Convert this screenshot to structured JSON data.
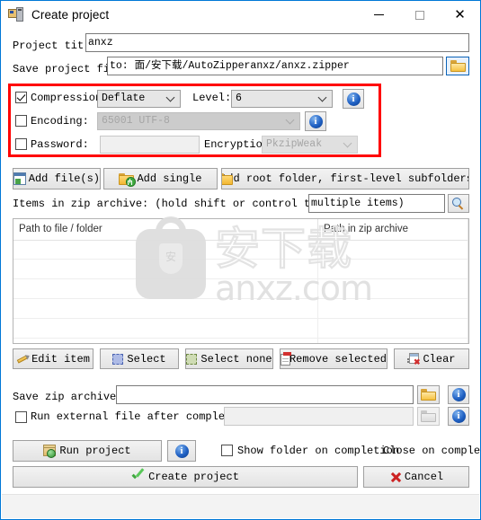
{
  "window": {
    "title": "Create project",
    "icon": "computer-project-icon",
    "minimize": "—",
    "maximize": "□",
    "close": "✕",
    "accent": "#0078d7",
    "highlight_color": "#ff0000"
  },
  "project": {
    "title_label": "Project tit",
    "title_value": "anxz",
    "save_file_label": "Save project file",
    "save_file_value": "to: 面/安下载/AutoZipperanxz/anxz.zipper",
    "browse_icon": "folder-open-icon"
  },
  "options": {
    "compression": {
      "label": "Compression:",
      "checked": true,
      "value": "Deflate"
    },
    "level": {
      "label": "Level:",
      "value": "6"
    },
    "compression_info_icon": "info-icon",
    "encoding": {
      "label": "Encoding:",
      "checked": false,
      "value": "65001 UTF-8",
      "disabled": true
    },
    "encoding_info_icon": "info-icon",
    "password": {
      "label": "Password:",
      "checked": false,
      "value": ""
    },
    "encryption": {
      "label": "Encryption:",
      "value": "PkzipWeak",
      "disabled": true
    }
  },
  "add_buttons": [
    {
      "label": "Add file(s)",
      "icon": "add-file-icon"
    },
    {
      "label": "Add single",
      "icon": "add-folder-icon"
    },
    {
      "label": "Add root folder, first-level subfolders",
      "icon": "add-root-folder-icon"
    }
  ],
  "items_bar": {
    "label": "Items in zip archive: (hold shift or control to select",
    "field_value": "multiple items)",
    "search_icon": "magnifier-icon"
  },
  "list": {
    "columns": [
      "Path to file / folder",
      "Path in zip archive"
    ],
    "rows": [],
    "empty_row_count": 6
  },
  "watermark": {
    "chinese": "安下载",
    "domain": "anxz.com",
    "shield_char": "安"
  },
  "item_buttons": [
    {
      "label": "Edit item",
      "icon": "pencil-icon"
    },
    {
      "label": "Select",
      "icon": "selection-box-icon"
    },
    {
      "label": "Select none",
      "icon": "deselection-box-icon"
    },
    {
      "label": "Remove selected",
      "icon": "remove-clipboard-icon"
    },
    {
      "label": "Clear",
      "icon": "clear-list-icon"
    }
  ],
  "output": {
    "save_label": "Save zip archive to:",
    "save_value": "",
    "save_browse_icon": "folder-open-icon",
    "save_info_icon": "info-icon",
    "run_external_label": "Run external file after completion:",
    "run_external_checked": false,
    "run_external_value": "",
    "run_external_browse_icon": "folder-open-disabled-icon",
    "run_external_info_icon": "info-icon"
  },
  "footer": {
    "run_project_label": "Run project",
    "run_project_icon": "package-run-icon",
    "run_info_icon": "info-icon",
    "show_folder_label": "Show folder on completion",
    "show_folder_checked": false,
    "close_on_completion_label": "Close on completion",
    "create_project_label": "Create project",
    "create_project_icon": "green-check-icon",
    "cancel_label": "Cancel",
    "cancel_icon": "red-x-icon"
  }
}
